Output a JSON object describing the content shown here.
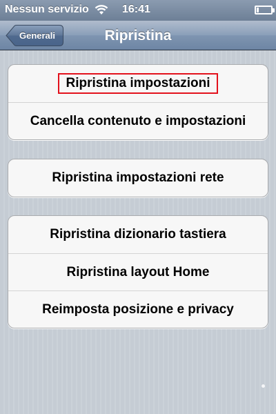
{
  "status_bar": {
    "carrier": "Nessun servizio",
    "time": "16:41",
    "wifi_icon": "wifi-icon",
    "battery_icon": "battery-icon",
    "battery_level": 0.15
  },
  "nav_bar": {
    "back_label": "Generali",
    "title": "Ripristina"
  },
  "groups": [
    {
      "items": [
        {
          "label": "Ripristina impostazioni",
          "highlighted": true
        },
        {
          "label": "Cancella contenuto e impostazioni"
        }
      ]
    },
    {
      "items": [
        {
          "label": "Ripristina impostazioni rete"
        }
      ]
    },
    {
      "items": [
        {
          "label": "Ripristina dizionario tastiera"
        },
        {
          "label": "Ripristina layout Home"
        },
        {
          "label": "Reimposta posizione e privacy"
        }
      ]
    }
  ],
  "colors": {
    "highlight_border": "#e3101b",
    "nav_bar": "#6d85a4",
    "background": "#c5ccd4"
  }
}
